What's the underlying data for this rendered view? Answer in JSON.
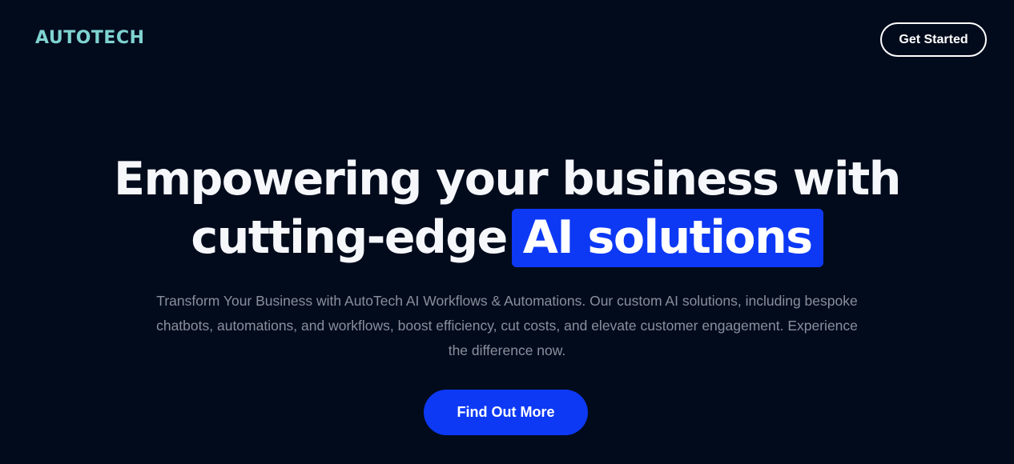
{
  "header": {
    "logo_text": "AUTOTECH",
    "cta_label": "Get Started"
  },
  "hero": {
    "headline_line1": "Empowering your business with",
    "headline_line2_prefix": "cutting-edge",
    "headline_highlight": "AI solutions",
    "subtext": "Transform Your Business with AutoTech AI Workflows & Automations. Our custom AI solutions, including bespoke chatbots, automations, and workflows, boost efficiency, cut costs, and elevate customer engagement. Experience the difference now.",
    "button_label": "Find Out More"
  },
  "colors": {
    "background": "#020b1c",
    "logo": "#7fd3d1",
    "accent": "#0d39f5",
    "subtext": "#8a8f9c"
  }
}
